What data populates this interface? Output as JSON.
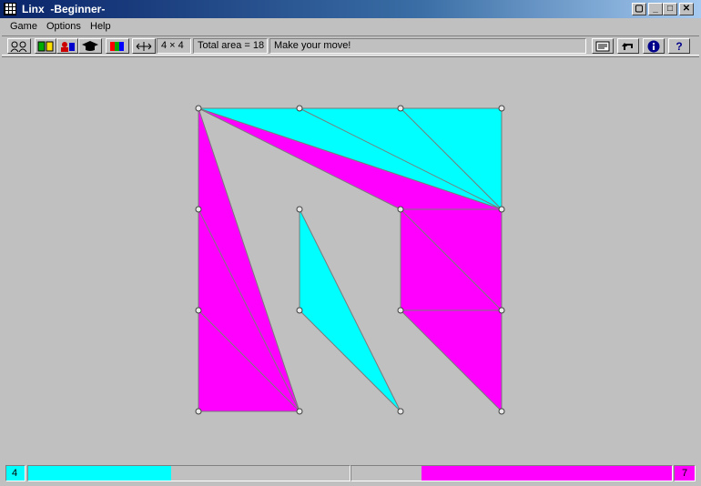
{
  "window": {
    "title": "Linx  -Beginner-"
  },
  "menu": [
    "Game",
    "Options",
    "Help"
  ],
  "toolbar": {
    "size": "4 × 4",
    "area": "Total area = 18",
    "status": "Make your move!"
  },
  "colors": {
    "cyan": "#00ffff",
    "magenta": "#ff00ff"
  },
  "icons": [
    "players-icon",
    "new-game-icon",
    "opponent-icon",
    "teacher-icon",
    "color-icon",
    "resize-icon",
    "hint-icon",
    "undo-icon",
    "info-icon",
    "help-icon"
  ],
  "score": {
    "cyan": "4",
    "magenta": "7"
  }
}
